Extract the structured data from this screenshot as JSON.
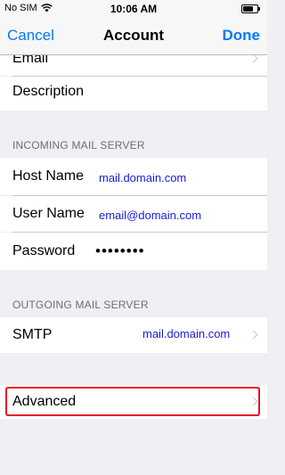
{
  "status_bar": {
    "carrier": "No SIM",
    "time": "10:06 AM"
  },
  "nav": {
    "cancel": "Cancel",
    "title": "Account",
    "done": "Done"
  },
  "account": {
    "email_label": "Email",
    "description_label": "Description"
  },
  "incoming": {
    "header": "INCOMING MAIL SERVER",
    "host_label": "Host Name",
    "host_value": "mail.domain.com",
    "user_label": "User Name",
    "user_value": "email@domain.com",
    "password_label": "Password",
    "password_value": "••••••••"
  },
  "outgoing": {
    "header": "OUTGOING MAIL SERVER",
    "smtp_label": "SMTP",
    "smtp_value": "mail.domain.com"
  },
  "advanced": {
    "label": "Advanced"
  },
  "colors": {
    "accent": "#007aff",
    "value_text": "#1a1adf",
    "highlight": "#e8102a"
  }
}
